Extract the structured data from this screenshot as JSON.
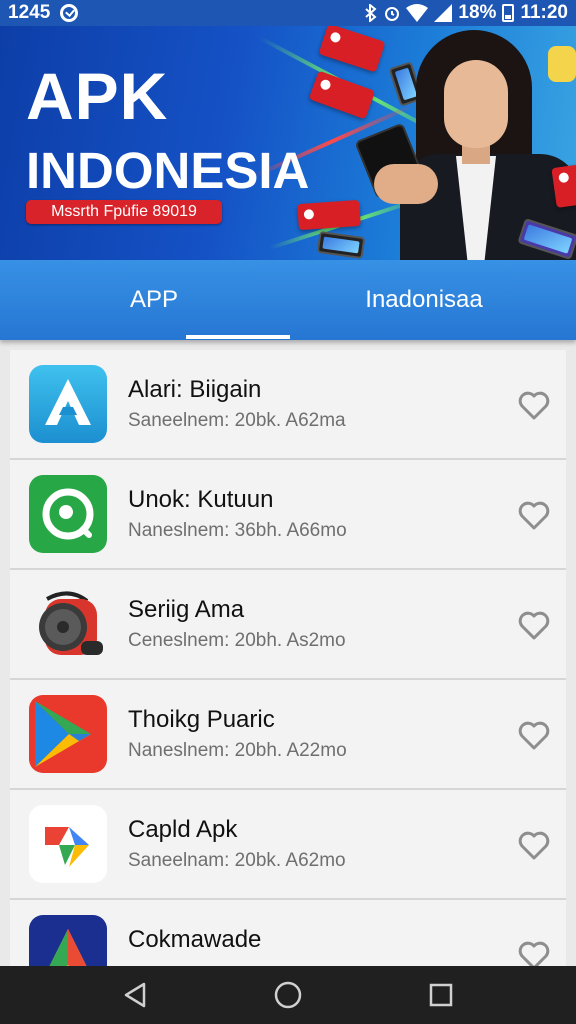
{
  "status_bar": {
    "time_left": "1245",
    "battery_percent": "18%",
    "clock": "11:20",
    "icons": [
      "check-circle-icon",
      "bluetooth-icon",
      "alarm-icon",
      "wifi-icon",
      "signal-icon",
      "battery-icon"
    ]
  },
  "banner": {
    "title": "APK",
    "subtitle": "INDONESIA",
    "tagline": "Mssrth Fpu̇fie 89019"
  },
  "tabs": [
    {
      "label": "APP",
      "selected": true
    },
    {
      "label": "Inadonisaa",
      "selected": false
    }
  ],
  "apps": [
    {
      "name": "Alari: Biigain",
      "meta": "Saneelnem: 20bk. A62ma",
      "icon": "blue-a-logo-icon"
    },
    {
      "name": "Unok: Kutuun",
      "meta": "Naneslnem: 36bh. A66mo",
      "icon": "green-circle-logo-icon"
    },
    {
      "name": "Seriig Ama",
      "meta": "Ceneslnem: 20bh. As2mo",
      "icon": "red-speaker-icon"
    },
    {
      "name": "Thoikg Puaric",
      "meta": "Naneslnem: 20bh. A22mo",
      "icon": "play-store-icon"
    },
    {
      "name": "Capld Apk",
      "meta": "Saneelnam: 20bk. A62mo",
      "icon": "colorful-arrow-logo-icon"
    },
    {
      "name": "Cokmawade",
      "meta": "",
      "icon": "triangle-logo-icon"
    }
  ],
  "colors": {
    "status_bar": "#1e56b3",
    "tab_bar": "#2c80da",
    "banner_tag": "#d8232a",
    "nav_bar": "#202020"
  },
  "nav": [
    "back-icon",
    "home-icon",
    "recents-icon"
  ]
}
